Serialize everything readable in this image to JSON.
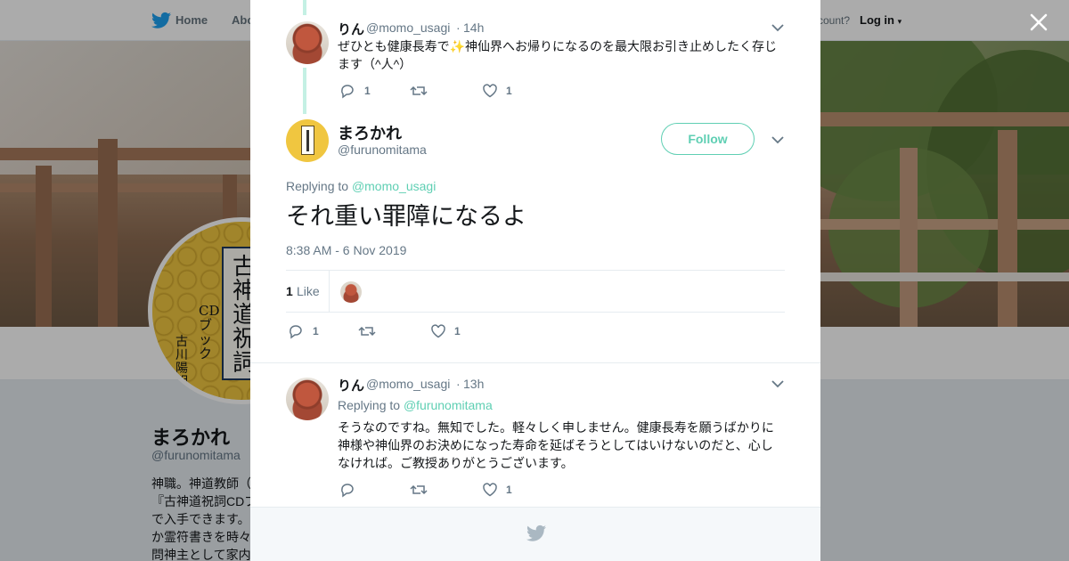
{
  "nav": {
    "home": "Home",
    "about": "Abo",
    "have_account": "ccount?",
    "login": "Log in"
  },
  "profile": {
    "avatar_text": "古神道祝詞",
    "avatar_sub": "CDブック",
    "avatar_author": "古川陽明",
    "name": "まろかれ",
    "handle": "@furunomitama",
    "bio": "神職。神道教師（\n『古神道祝詞CDブ\nで入手できます。\nか霊符書きを時々\n問神主として家内"
  },
  "thread": {
    "parent": {
      "name": "りん",
      "handle": "@momo_usagi",
      "sep": "·",
      "time": "14h",
      "text": "ぜひとも健康長寿で✨神仙界へお帰りになるのを最大限お引き止めしたく存じます（^人^）",
      "replies": "1",
      "likes": "1"
    },
    "main": {
      "name": "まろかれ",
      "handle": "@furunomitama",
      "follow": "Follow",
      "replying_prefix": "Replying to",
      "replying_to": "@momo_usagi",
      "text": "それ重い罪障になるよ",
      "date": "8:38 AM - 6 Nov 2019",
      "like_count": "1",
      "like_label": "Like",
      "replies": "1",
      "likes": "1"
    },
    "reply": {
      "name": "りん",
      "handle": "@momo_usagi",
      "sep": "·",
      "time": "13h",
      "replying_prefix": "Replying to",
      "replying_to": "@furunomitama",
      "text": "そうなのですね。無知でした。軽々しく申しません。健康長寿を願うばかりに神様や神仙界のお決めになった寿命を延ばそうとしてはいけないのだと、心しなければ。ご教授ありがとうございます。",
      "likes": "1"
    }
  },
  "colors": {
    "accent": "#5fcfb3",
    "twitter_blue": "#1da1f2",
    "muted": "#657786"
  },
  "icons": [
    "twitter-bird-icon",
    "close-icon",
    "chevron-down-icon",
    "reply-icon",
    "retweet-icon",
    "heart-icon",
    "sparkles-emoji"
  ]
}
